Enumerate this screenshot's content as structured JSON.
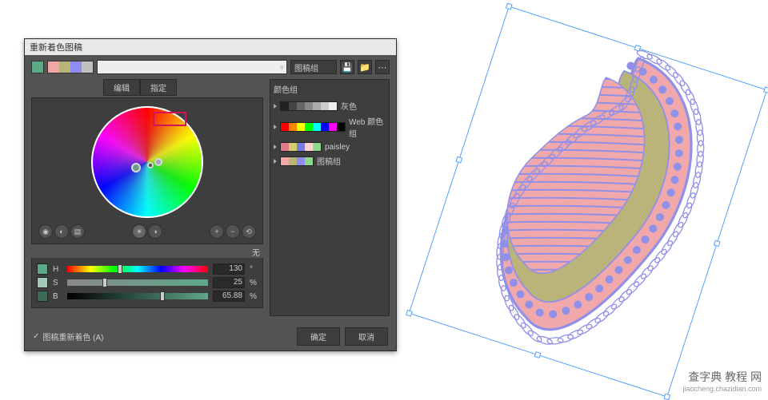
{
  "dialog": {
    "title": "重新着色图稿",
    "top_swatch": "#5ea88a",
    "swatch_strip": [
      "#f1a6a8",
      "#bab37a",
      "#8e8ef0",
      "#c0c0c0"
    ],
    "dropdown_label": "图稿组",
    "tabs": {
      "edit": "编辑",
      "specify": "指定"
    },
    "none_label": "无"
  },
  "sliders": {
    "h": {
      "label": "H",
      "value": "130",
      "unit": "°",
      "swatch": "#5ea88a",
      "gradient": "linear-gradient(90deg,red,yellow,lime,cyan,blue,magenta,red)",
      "pos": 36
    },
    "s": {
      "label": "S",
      "value": "25",
      "unit": "%",
      "swatch": "#a4c9b7",
      "gradient": "linear-gradient(90deg,#888,#5ea88a)",
      "pos": 25
    },
    "b": {
      "label": "B",
      "value": "65.88",
      "unit": "%",
      "swatch": "#3d6b58",
      "gradient": "linear-gradient(90deg,#000,#5ea88a)",
      "pos": 66
    }
  },
  "color_groups": {
    "title": "颜色组",
    "rows": [
      {
        "name": "灰色",
        "strip": [
          "#222",
          "#444",
          "#666",
          "#888",
          "#aaa",
          "#ccc",
          "#eee"
        ]
      },
      {
        "name": "Web 颜色组",
        "strip": [
          "#f00",
          "#f80",
          "#ff0",
          "#0f0",
          "#0ff",
          "#00f",
          "#f0f",
          "#000"
        ]
      },
      {
        "name": "paisley",
        "strip": [
          "#e27a8a",
          "#d7cc6c",
          "#7b7bdb",
          "#ffd0d0",
          "#90d790"
        ]
      },
      {
        "name": "图稿组",
        "strip": [
          "#f1a6a8",
          "#bab37a",
          "#8e8ef0",
          "#90d790"
        ]
      }
    ]
  },
  "footer": {
    "checkbox_label": "图稿重新着色 (A)",
    "ok": "确定",
    "cancel": "取消"
  },
  "watermark": {
    "main": "查字典 教程 网",
    "sub": "jiaocheng.chazidian.com"
  },
  "art_colors": {
    "outline": "#9090e8",
    "outer": "#f1a8aa",
    "mid": "#bab37a",
    "inner": "#9090e8"
  }
}
